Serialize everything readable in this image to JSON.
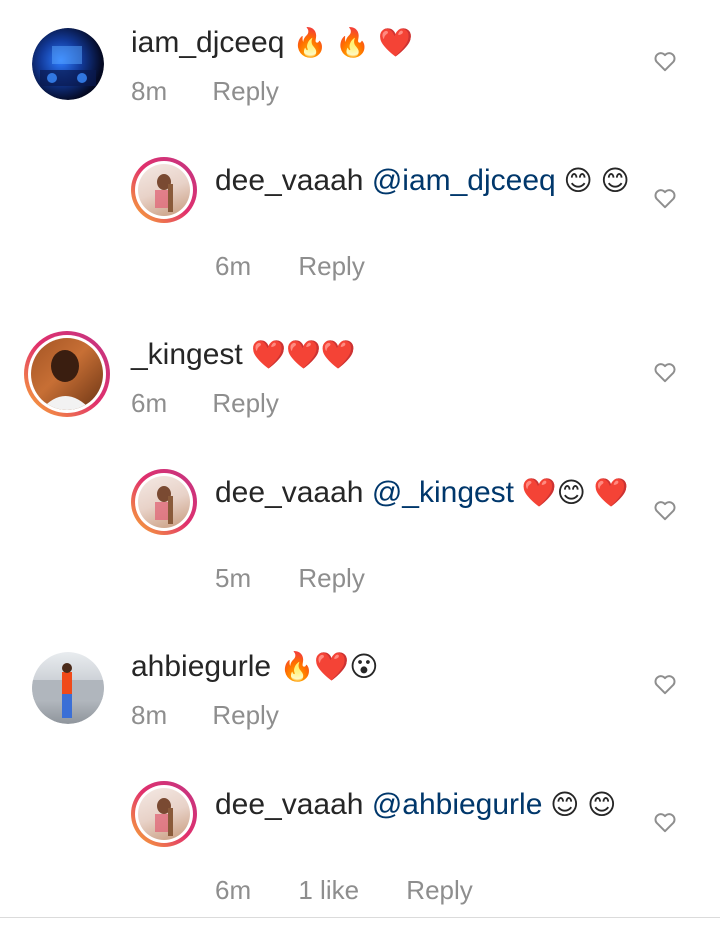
{
  "comments": [
    {
      "username": "iam_djceeq",
      "mention": "",
      "text_emoji": "🔥 🔥 ❤️",
      "time": "8m",
      "likes": "",
      "reply_label": "Reply"
    },
    {
      "username": "dee_vaaah",
      "mention": "@iam_djceeq",
      "text_emoji": " 😊 😊",
      "time": "6m",
      "likes": "",
      "reply_label": "Reply"
    },
    {
      "username": "_kingest",
      "mention": "",
      "text_emoji": "❤️❤️❤️",
      "time": "6m",
      "likes": "",
      "reply_label": "Reply"
    },
    {
      "username": "dee_vaaah",
      "mention": "@_kingest",
      "text_emoji": " ❤️😊 ❤️",
      "time": "5m",
      "likes": "",
      "reply_label": "Reply"
    },
    {
      "username": "ahbiegurle",
      "mention": "",
      "text_emoji": "🔥❤️😮",
      "time": "8m",
      "likes": "",
      "reply_label": "Reply"
    },
    {
      "username": "dee_vaaah",
      "mention": "@ahbiegurle",
      "text_emoji": " 😊 😊",
      "time": "6m",
      "likes": "1 like",
      "reply_label": "Reply"
    }
  ],
  "icons": {
    "like": "heart-outline-icon"
  },
  "colors": {
    "mention": "#00376b",
    "meta": "#8e8e8e",
    "story_ring_start": "#f9b233",
    "story_ring_end": "#c13584"
  }
}
